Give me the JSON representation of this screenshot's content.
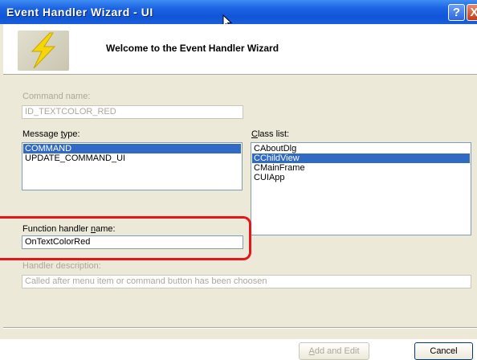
{
  "window": {
    "title": "Event Handler Wizard - UI",
    "help_label": "?",
    "close_label": "X"
  },
  "header": {
    "welcome": "Welcome to the Event Handler Wizard"
  },
  "form": {
    "command_name": {
      "label": "Command name:",
      "value": "ID_TEXTCOLOR_RED",
      "enabled": false
    },
    "message_type": {
      "label_pre": "Message ",
      "label_ul": "t",
      "label_post": "ype:",
      "items": [
        "COMMAND",
        "UPDATE_COMMAND_UI"
      ],
      "selected": "COMMAND"
    },
    "class_list": {
      "label_ul": "C",
      "label_post": "lass list:",
      "items": [
        "CAboutDlg",
        "CChildView",
        "CMainFrame",
        "CUIApp"
      ],
      "selected": "CChildView"
    },
    "function_handler": {
      "label_pre": "Function handler ",
      "label_ul": "n",
      "label_post": "ame:",
      "value": "OnTextColorRed"
    },
    "handler_description": {
      "label": "Handler description:",
      "value": "Called after menu item or command button has been choosen",
      "enabled": false
    }
  },
  "buttons": {
    "add_edit_ul": "A",
    "add_edit_post": "dd and Edit",
    "add_edit_enabled": false,
    "cancel": "Cancel"
  },
  "colors": {
    "title_bar": "#0f55d8",
    "selection": "#316ac5",
    "dialog_bg": "#ece9d8",
    "annotation": "#e8141a"
  }
}
